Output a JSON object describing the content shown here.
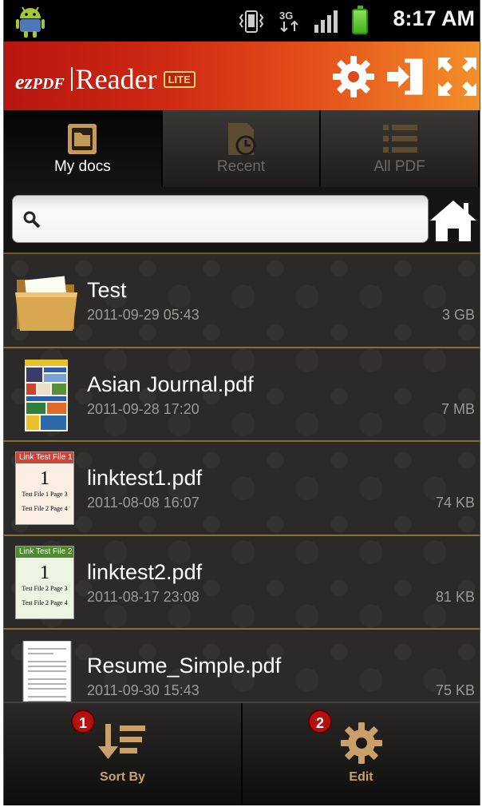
{
  "status_bar": {
    "time": "8:17 AM",
    "network": "3G",
    "icons": [
      "android-icon",
      "vibrate-icon",
      "data-3g-icon",
      "signal-icon",
      "battery-icon"
    ]
  },
  "header": {
    "logo_ez": "ez",
    "logo_pdf": "PDF",
    "logo_reader": "Reader",
    "logo_lite": "LITE",
    "icons": [
      "settings-gear-icon",
      "exit-door-icon",
      "fullscreen-icon"
    ]
  },
  "tabs": [
    {
      "label": "My docs",
      "icon": "folder-icon",
      "active": true
    },
    {
      "label": "Recent",
      "icon": "recent-clock-icon",
      "active": false
    },
    {
      "label": "All PDF",
      "icon": "list-icon",
      "active": false
    }
  ],
  "search": {
    "placeholder": "",
    "value": ""
  },
  "files": [
    {
      "name": "Test",
      "date": "2011-09-29 05:43",
      "size": "3 GB",
      "type": "folder"
    },
    {
      "name": "Asian Journal.pdf",
      "date": "2011-09-28 17:20",
      "size": "7 MB",
      "type": "pdf-magazine"
    },
    {
      "name": "linktest1.pdf",
      "date": "2011-08-08 16:07",
      "size": "74 KB",
      "type": "pdf",
      "thumb": {
        "header": "Link Test File 1",
        "num": "1",
        "line1": "Test File 1 Page 3",
        "line2": "Test File 2 Page 4"
      }
    },
    {
      "name": "linktest2.pdf",
      "date": "2011-08-17 23:08",
      "size": "81 KB",
      "type": "pdf",
      "thumb": {
        "header": "Link Test File 2",
        "num": "1",
        "line1": "Test File 2 Page 3",
        "line2": "Test File 2 Page 4"
      }
    },
    {
      "name": "Resume_Simple.pdf",
      "date": "2011-09-30 15:43",
      "size": "75 KB",
      "type": "pdf-document"
    }
  ],
  "bottom_bar": {
    "sort_label": "Sort By",
    "edit_label": "Edit",
    "badge_sort": "1",
    "badge_edit": "2"
  },
  "colors": {
    "header_start": "#b8150f",
    "header_end": "#f38f2a",
    "accent_gold": "#c9a06a",
    "badge_red": "#b51010"
  }
}
